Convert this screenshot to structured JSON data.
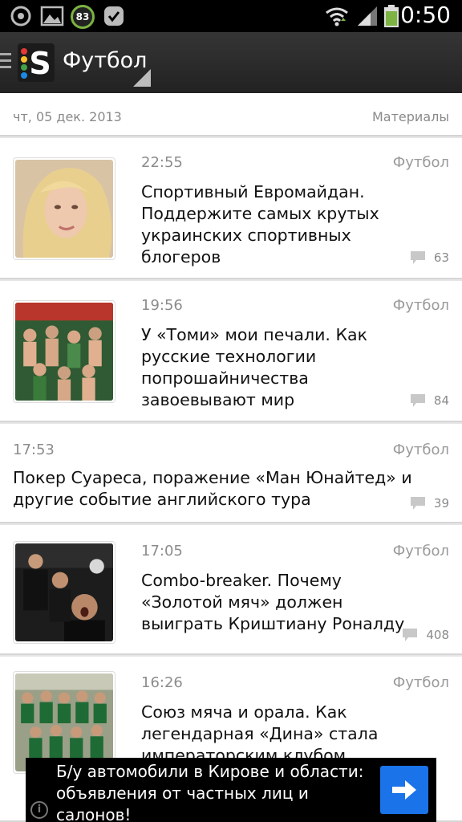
{
  "status_bar": {
    "time": "0:50",
    "battery_badge": "83",
    "icons": [
      "power-icon",
      "gallery-icon",
      "battery-saver-icon",
      "check-icon",
      "wifi-icon",
      "signal-icon",
      "battery-icon"
    ]
  },
  "action_bar": {
    "title": "Футбол",
    "logo_letter": "S"
  },
  "date_header": {
    "date": "чт, 05 дек. 2013",
    "section": "Материалы"
  },
  "feed": [
    {
      "time": "22:55",
      "category": "Футбол",
      "title": "Спортивный Евромайдан. Поддержите самых крутых украинских спортивных блогеров",
      "comments": "63",
      "thumbnail": "portrait-photo"
    },
    {
      "time": "19:56",
      "category": "Футбол",
      "title": "У «Томи» мои печали. Как русские технологии попрошайничества завоевывают мир",
      "comments": "84",
      "thumbnail": "fans-photo"
    },
    {
      "time": "17:53",
      "category": "Футбол",
      "title": "Покер Суареса, поражение «Ман Юнайтед» и другие событие английского тура",
      "comments": "39",
      "thumbnail": ""
    },
    {
      "time": "17:05",
      "category": "Футбол",
      "title": "Combo-breaker. Почему «Золотой мяч» должен выиграть Криштиану Роналду",
      "comments": "408",
      "thumbnail": "player-photo"
    },
    {
      "time": "16:26",
      "category": "Футбол",
      "title": "Союз мяча и орала. Как легендарная «Дина» стала императорским клубом",
      "comments": "",
      "thumbnail": "team-photo"
    }
  ],
  "ad": {
    "text": "Б/у автомобили в Кирове и области: объявления от частных лиц и салонов!",
    "info_icon": "i",
    "button_icon": "arrow-right-icon",
    "button_color": "#1a73e8"
  }
}
